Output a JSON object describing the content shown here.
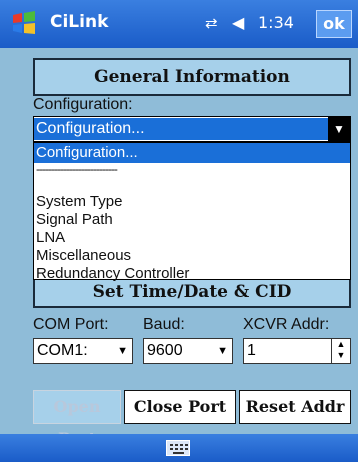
{
  "titlebar": {
    "title": "CiLink",
    "clock": "1:34",
    "ok_label": "ok",
    "icons": [
      "windows-flag-icon",
      "network-icon",
      "volume-icon"
    ]
  },
  "general": {
    "label": "General Information"
  },
  "configuration": {
    "label": "Configuration:",
    "selected": "Configuration...",
    "options": [
      "Configuration...",
      "---------------------------",
      "System Type",
      "Signal Path",
      "LNA",
      "Miscellaneous",
      "Redundancy Controller"
    ]
  },
  "settime": {
    "label": "Set Time/Date & CID"
  },
  "port": {
    "com_label": "COM Port:",
    "com_value": "COM1:",
    "baud_label": "Baud:",
    "baud_value": "9600",
    "xcvr_label": "XCVR Addr:",
    "xcvr_value": "1"
  },
  "actions": {
    "open": "Open Port",
    "close": "Close Port",
    "reset": "Reset Addr"
  },
  "colors": {
    "background": "#8fbcd8",
    "titlebar": "#1a5cc8",
    "selection": "#1a6fd8"
  }
}
